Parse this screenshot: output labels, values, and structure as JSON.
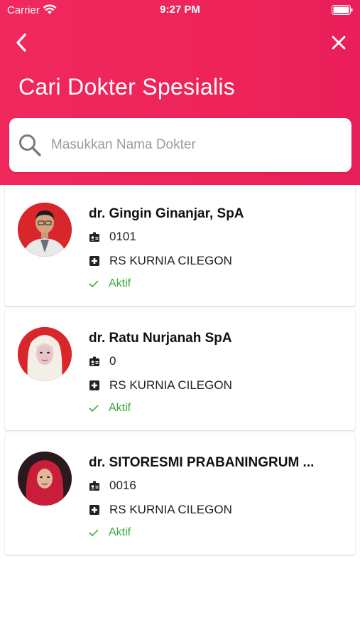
{
  "status_bar": {
    "carrier": "Carrier",
    "time": "9:27 PM"
  },
  "header": {
    "title": "Cari Dokter Spesialis",
    "back_icon": "chevron-left-icon",
    "close_icon": "close-icon"
  },
  "search": {
    "placeholder": "Masukkan Nama Dokter",
    "value": "",
    "icon": "search-icon"
  },
  "colors": {
    "header_gradient_start": "#f0285d",
    "header_gradient_end": "#e91e5a",
    "status_active": "#3aa641"
  },
  "doctors": [
    {
      "name": "dr. Gingin Ginanjar, SpA",
      "id": "0101",
      "hospital": "RS KURNIA CILEGON",
      "status": "Aktif",
      "avatar_bg": "#d8262b"
    },
    {
      "name": "dr. Ratu Nurjanah SpA",
      "id": "0",
      "hospital": "RS KURNIA CILEGON",
      "status": "Aktif",
      "avatar_bg": "#d8262b"
    },
    {
      "name": "dr. SITORESMI PRABANINGRUM ...",
      "id": "0016",
      "hospital": "RS KURNIA CILEGON",
      "status": "Aktif",
      "avatar_bg": "#c9202a"
    }
  ]
}
